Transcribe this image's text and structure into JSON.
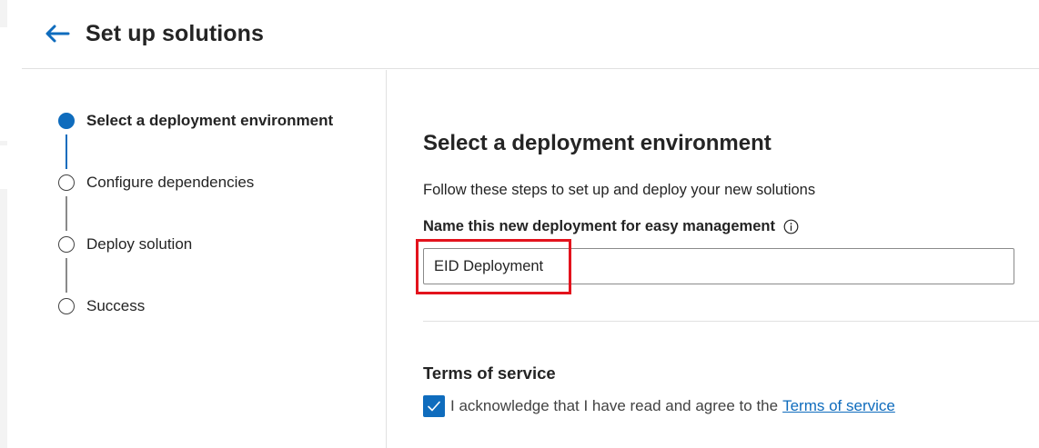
{
  "header": {
    "title": "Set up solutions",
    "back_icon": "arrow-left-icon",
    "accent_color": "#0f6cbd"
  },
  "steps": [
    {
      "label": "Select a deployment environment",
      "state": "active"
    },
    {
      "label": "Configure dependencies",
      "state": "pending"
    },
    {
      "label": "Deploy solution",
      "state": "pending"
    },
    {
      "label": "Success",
      "state": "pending"
    }
  ],
  "main": {
    "heading": "Select a deployment environment",
    "intro": "Follow these steps to set up and deploy your new solutions",
    "name_field": {
      "label": "Name this new deployment for easy management",
      "value": "EID Deployment",
      "info_icon": "info-icon"
    },
    "highlight_color": "#e3131d",
    "terms": {
      "heading": "Terms of service",
      "checked": true,
      "text": "I acknowledge that I have read and agree to the",
      "link": "Terms of service"
    }
  }
}
